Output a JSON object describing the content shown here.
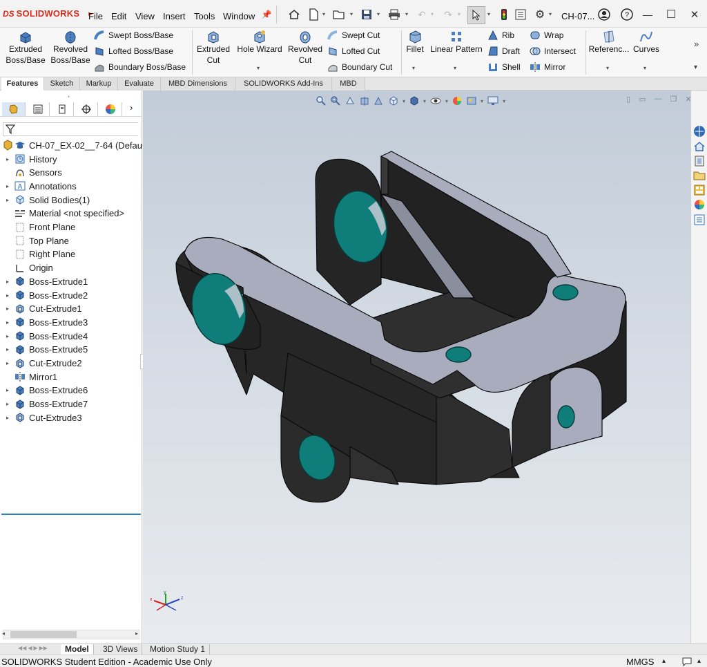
{
  "app": {
    "brand": "SOLIDWORKS",
    "brand_mark": "DS",
    "menu": [
      "File",
      "Edit",
      "View",
      "Insert",
      "Tools",
      "Window"
    ],
    "doc_title": "CH-07...",
    "window_controls": {
      "minimize": "—",
      "maximize": "☐",
      "close": "✕"
    }
  },
  "command_manager": {
    "extruded_boss": "Extruded\nBoss/Base",
    "revolved_boss": "Revolved\nBoss/Base",
    "swept_boss": "Swept Boss/Base",
    "lofted_boss": "Lofted Boss/Base",
    "boundary_boss": "Boundary Boss/Base",
    "extruded_cut": "Extruded\nCut",
    "hole_wizard": "Hole Wizard",
    "revolved_cut": "Revolved\nCut",
    "swept_cut": "Swept Cut",
    "lofted_cut": "Lofted Cut",
    "boundary_cut": "Boundary Cut",
    "fillet": "Fillet",
    "linear_pattern": "Linear Pattern",
    "rib": "Rib",
    "draft": "Draft",
    "shell": "Shell",
    "wrap": "Wrap",
    "intersect": "Intersect",
    "mirror": "Mirror",
    "reference": "Referenc...",
    "curves": "Curves"
  },
  "tabs": [
    "Features",
    "Sketch",
    "Markup",
    "Evaluate",
    "MBD Dimensions",
    "SOLIDWORKS Add-Ins",
    "MBD"
  ],
  "feature_tree": {
    "root": "CH-07_EX-02__7-64  (Defau",
    "items": [
      {
        "label": "History",
        "icon": "history-icon",
        "expandable": true
      },
      {
        "label": "Sensors",
        "icon": "sensors-icon",
        "expandable": false
      },
      {
        "label": "Annotations",
        "icon": "annotations-icon",
        "expandable": true
      },
      {
        "label": "Solid Bodies(1)",
        "icon": "solid-bodies-icon",
        "expandable": true
      },
      {
        "label": "Material <not specified>",
        "icon": "material-icon",
        "expandable": false
      },
      {
        "label": "Front Plane",
        "icon": "plane-icon",
        "expandable": false
      },
      {
        "label": "Top Plane",
        "icon": "plane-icon",
        "expandable": false
      },
      {
        "label": "Right Plane",
        "icon": "plane-icon",
        "expandable": false
      },
      {
        "label": "Origin",
        "icon": "origin-icon",
        "expandable": false
      },
      {
        "label": "Boss-Extrude1",
        "icon": "boss-extrude-icon",
        "expandable": true
      },
      {
        "label": "Boss-Extrude2",
        "icon": "boss-extrude-icon",
        "expandable": true
      },
      {
        "label": "Cut-Extrude1",
        "icon": "cut-extrude-icon",
        "expandable": true
      },
      {
        "label": "Boss-Extrude3",
        "icon": "boss-extrude-icon",
        "expandable": true
      },
      {
        "label": "Boss-Extrude4",
        "icon": "boss-extrude-icon",
        "expandable": true
      },
      {
        "label": "Boss-Extrude5",
        "icon": "boss-extrude-icon",
        "expandable": true
      },
      {
        "label": "Cut-Extrude2",
        "icon": "cut-extrude-icon",
        "expandable": true
      },
      {
        "label": "Mirror1",
        "icon": "mirror-icon",
        "expandable": false
      },
      {
        "label": "Boss-Extrude6",
        "icon": "boss-extrude-icon",
        "expandable": true
      },
      {
        "label": "Boss-Extrude7",
        "icon": "boss-extrude-icon",
        "expandable": true
      },
      {
        "label": "Cut-Extrude3",
        "icon": "cut-extrude-icon",
        "expandable": true
      }
    ]
  },
  "bottom_tabs": [
    "Model",
    "3D Views",
    "Motion Study 1"
  ],
  "status": {
    "text": "SOLIDWORKS Student Edition - Academic Use Only",
    "units": "MMGS"
  },
  "triad": {
    "x": "x",
    "y": "y",
    "z": "z"
  },
  "colors": {
    "brand_red": "#d52b1e",
    "part_body": "#262626",
    "part_face": "#a9acbd",
    "hole": "#0f7d79",
    "accent_blue": "#2a82c5"
  }
}
